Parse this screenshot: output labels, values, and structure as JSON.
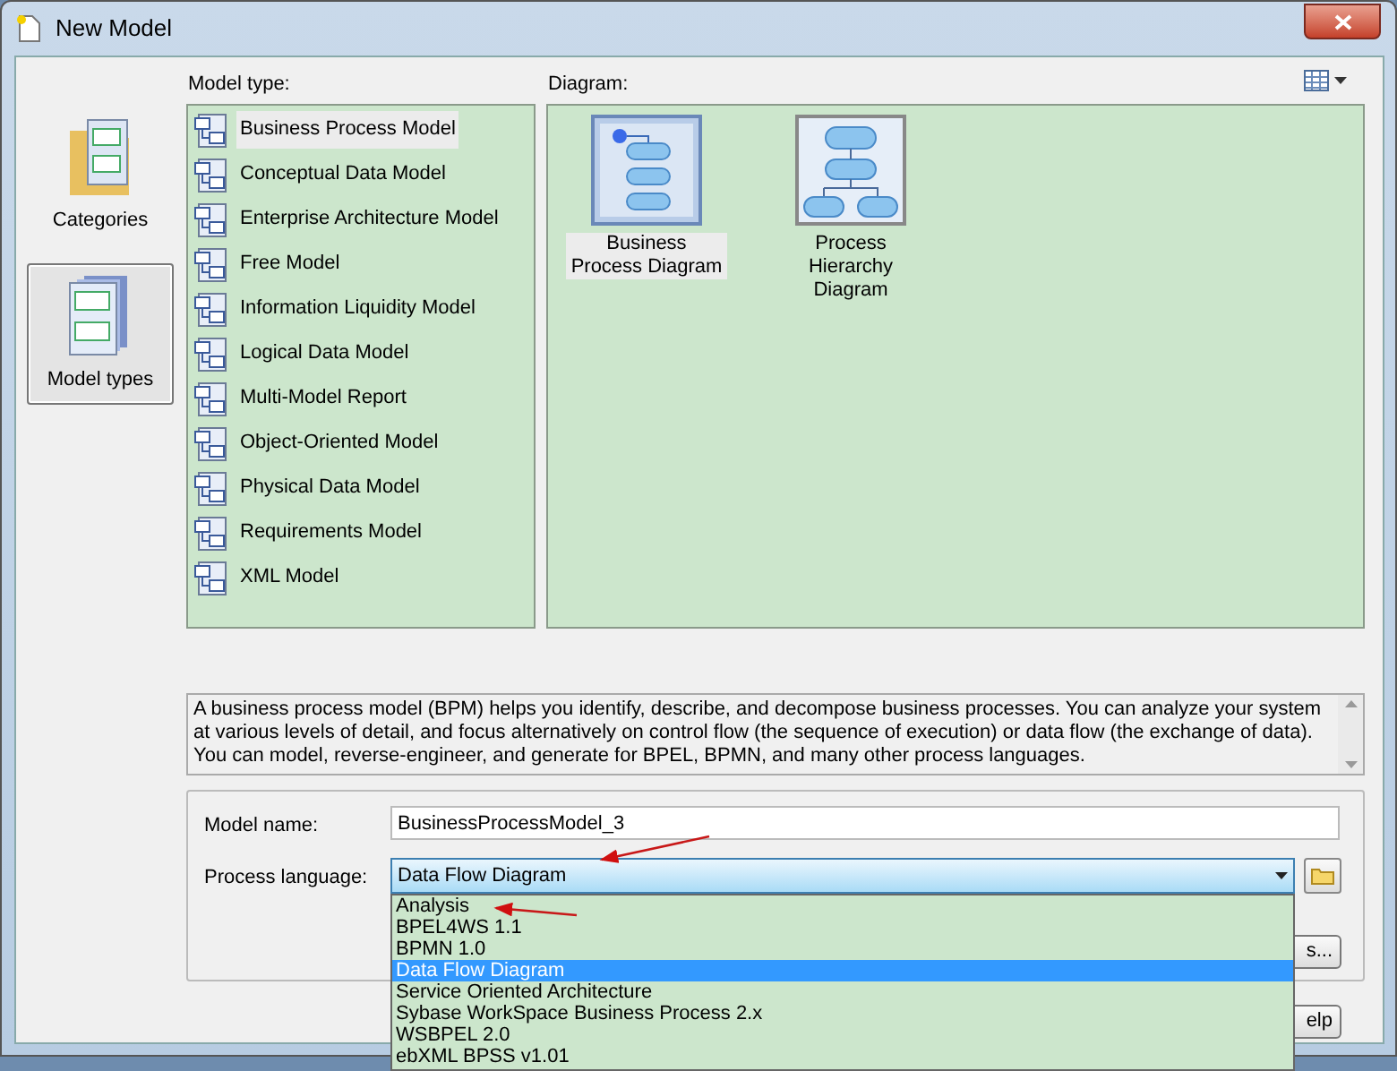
{
  "window": {
    "title": "New Model"
  },
  "categories": [
    {
      "label": "Categories",
      "selected": false
    },
    {
      "label": "Model types",
      "selected": true
    }
  ],
  "model_type": {
    "label": "Model type:",
    "items": [
      {
        "label": "Business Process Model",
        "selected": true
      },
      {
        "label": "Conceptual Data Model",
        "selected": false
      },
      {
        "label": "Enterprise Architecture Model",
        "selected": false
      },
      {
        "label": "Free Model",
        "selected": false
      },
      {
        "label": "Information Liquidity Model",
        "selected": false
      },
      {
        "label": "Logical Data Model",
        "selected": false
      },
      {
        "label": "Multi-Model Report",
        "selected": false
      },
      {
        "label": "Object-Oriented Model",
        "selected": false
      },
      {
        "label": "Physical Data Model",
        "selected": false
      },
      {
        "label": "Requirements Model",
        "selected": false
      },
      {
        "label": "XML Model",
        "selected": false
      }
    ]
  },
  "diagram": {
    "label": "Diagram:",
    "items": [
      {
        "label": "Business Process Diagram",
        "selected": true
      },
      {
        "label": "Process Hierarchy Diagram",
        "selected": false
      }
    ]
  },
  "description": [
    "A business process model (BPM) helps you identify, describe, and decompose business processes. You can analyze your system at various levels of detail, and focus alternatively on control flow (the sequence of execution) or data flow (the exchange of data).",
    "You can model, reverse-engineer, and generate for BPEL, BPMN, and many other process languages."
  ],
  "model_name": {
    "label": "Model name:",
    "value": "BusinessProcessModel_3"
  },
  "process_language": {
    "label": "Process language:",
    "value": "Data Flow Diagram",
    "expanded": true,
    "options": [
      {
        "label": "Analysis",
        "selected": false
      },
      {
        "label": "BPEL4WS 1.1",
        "selected": false
      },
      {
        "label": "BPMN 1.0",
        "selected": false
      },
      {
        "label": "Data Flow Diagram",
        "selected": true
      },
      {
        "label": "Service Oriented Architecture",
        "selected": false
      },
      {
        "label": "Sybase WorkSpace Business Process 2.x",
        "selected": false
      },
      {
        "label": "WSBPEL 2.0",
        "selected": false
      },
      {
        "label": "ebXML BPSS v1.01",
        "selected": false
      }
    ]
  },
  "covered_buttons": [
    "s...",
    "elp"
  ]
}
